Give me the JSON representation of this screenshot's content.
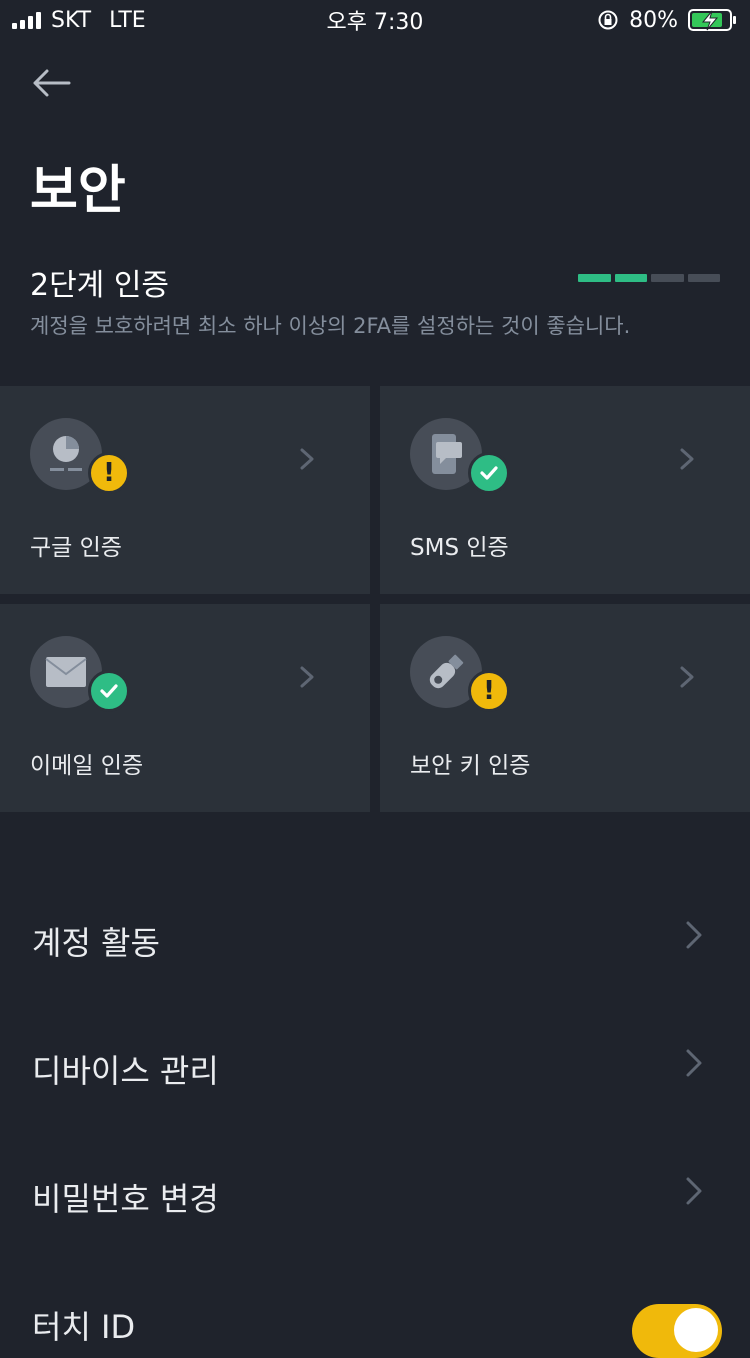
{
  "status_bar": {
    "carrier": "SKT",
    "network": "LTE",
    "time": "오후 7:30",
    "battery_percent": "80%"
  },
  "header": {
    "title": "보안"
  },
  "two_factor": {
    "title": "2단계 인증",
    "description": "계정을 보호하려면 최소 하나 이상의 2FA를 설정하는 것이 좋습니다.",
    "progress_enabled": 2,
    "progress_total": 4
  },
  "methods": [
    {
      "label": "구글 인증",
      "icon": "google-authenticator-icon",
      "status": "warning"
    },
    {
      "label": "SMS 인증",
      "icon": "phone-sms-icon",
      "status": "enabled"
    },
    {
      "label": "이메일 인증",
      "icon": "envelope-icon",
      "status": "enabled"
    },
    {
      "label": "보안 키 인증",
      "icon": "security-key-icon",
      "status": "warning"
    }
  ],
  "menu": [
    {
      "label": "계정 활동"
    },
    {
      "label": "디바이스 관리"
    },
    {
      "label": "비밀번호 변경"
    },
    {
      "label": "터치 ID"
    }
  ],
  "touch_id_enabled": true,
  "colors": {
    "background": "#1f232c",
    "card": "#2b3139",
    "accent_yellow": "#f0b90b",
    "success_green": "#2ebd85",
    "muted_text": "#848e9c"
  }
}
